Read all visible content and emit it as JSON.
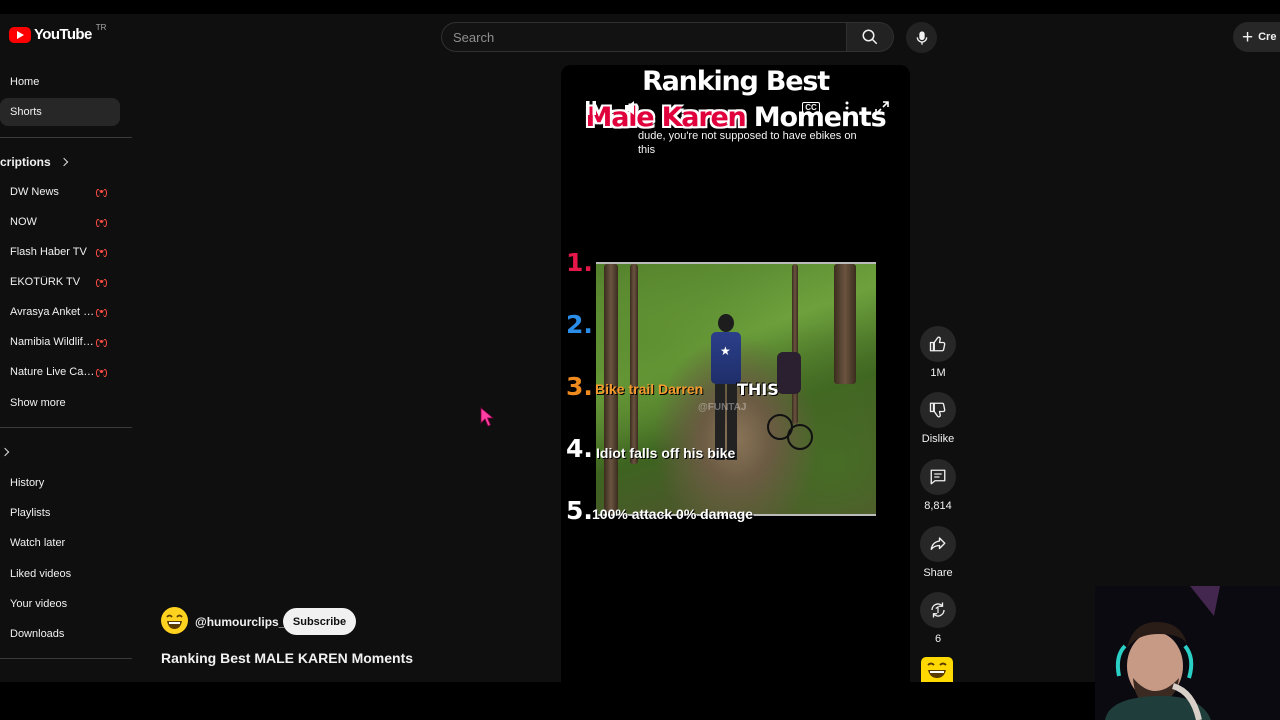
{
  "masthead": {
    "logo_text": "YouTube",
    "country_code": "TR",
    "search_placeholder": "Search",
    "create_label": "Cre"
  },
  "sidebar": {
    "home": "Home",
    "shorts": "Shorts",
    "subscriptions_header": "criptions",
    "subscriptions": [
      {
        "name": "DW News",
        "live": true
      },
      {
        "name": "NOW",
        "live": true
      },
      {
        "name": "Flash Haber TV",
        "live": true
      },
      {
        "name": "EKOTÜRK TV",
        "live": true
      },
      {
        "name": "Avrasya Anket (K...",
        "live": true
      },
      {
        "name": "Namibia Wildlife ...",
        "live": true
      },
      {
        "name": "Nature Live Cam...",
        "live": true
      }
    ],
    "show_more": "Show more",
    "you_items": [
      "History",
      "Playlists",
      "Watch later",
      "Liked videos",
      "Your videos",
      "Downloads"
    ]
  },
  "video": {
    "overlay_title_line1": "Ranking Best",
    "overlay_title_line2_highlight": "Male Karen",
    "overlay_title_line2_rest": "Moments",
    "caption": "dude, you're not supposed to have ebikes on this",
    "cc_label": "CC",
    "ranks": [
      {
        "num": "1.",
        "color": "#e5174a",
        "label": ""
      },
      {
        "num": "2.",
        "color": "#2a8ee8",
        "label": ""
      },
      {
        "num": "3.",
        "color": "#ef8a1e",
        "label": "Bike trail Darren"
      },
      {
        "num": "4.",
        "color": "#ffffff",
        "label": "Idiot falls off his bike"
      },
      {
        "num": "5.",
        "color": "#ffffff",
        "label": "100% attack 0% damage"
      }
    ],
    "clip_text": "THIS",
    "clip_watermark": "@FUNTAJ"
  },
  "actions": {
    "like_count": "1M",
    "dislike_label": "Dislike",
    "comment_count": "8,814",
    "share_label": "Share",
    "remix_count": "6"
  },
  "channel": {
    "handle": "@humourclips_",
    "subscribe_label": "Subscribe",
    "short_title": "Ranking Best MALE KAREN Moments"
  },
  "colors": {
    "accent_red": "#ff0000",
    "live_red": "#ff4e45",
    "background": "#0f0f0f",
    "cursor_pink": "#ff3fa4"
  }
}
